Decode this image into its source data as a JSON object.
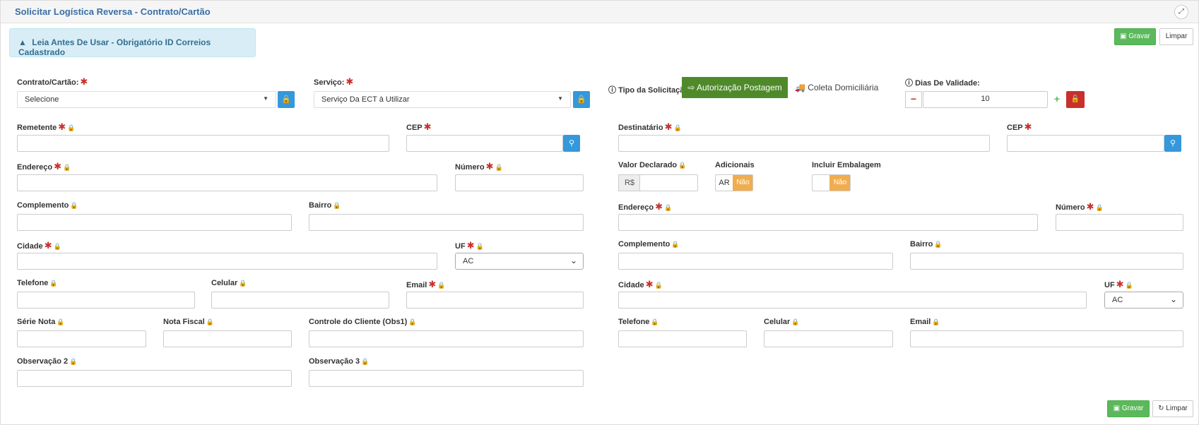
{
  "header": {
    "title": "Solicitar Logística Reversa - Contrato/Cartão",
    "expand_icon": "expand-icon"
  },
  "alert": {
    "text": "Leia Antes De Usar - Obrigatório ID Correios Cadastrado",
    "icon": "warning-icon"
  },
  "toolbar": {
    "save_label": "Gravar",
    "clear_label": "Limpar"
  },
  "footer": {
    "save_label": "Gravar",
    "clear_label": "Limpar"
  },
  "required_mark": "✱",
  "contrato": {
    "label": "Contrato/Cartão:",
    "value": "Selecione"
  },
  "servico": {
    "label": "Serviço:",
    "value": "Serviço Da ECT à Utilizar"
  },
  "tipo": {
    "label": "Tipo da Solicitação",
    "option_active": "Autorização Postagem",
    "option_other": "Coleta Domiciliária"
  },
  "validade": {
    "label": "Dias De Validade:",
    "value": "10"
  },
  "remetente": {
    "nome_label": "Remetente",
    "cep_label": "CEP",
    "endereco_label": "Endereço",
    "numero_label": "Número",
    "complemento_label": "Complemento",
    "bairro_label": "Bairro",
    "cidade_label": "Cidade",
    "uf_label": "UF",
    "uf_value": "AC",
    "telefone_label": "Telefone",
    "celular_label": "Celular",
    "email_label": "Email",
    "serie_label": "Série Nota",
    "nota_label": "Nota Fiscal",
    "controle_label": "Controle do Cliente (Obs1)",
    "obs2_label": "Observação 2",
    "obs3_label": "Observação 3"
  },
  "destinatario": {
    "nome_label": "Destinatário",
    "cep_label": "CEP",
    "valor_label": "Valor Declarado",
    "valor_prefix": "R$",
    "adicionais_label": "Adicionais",
    "ar_label": "AR",
    "ar_value": "Não",
    "embalagem_label": "Incluir Embalagem",
    "embalagem_value": "Não",
    "endereco_label": "Endereço",
    "numero_label": "Número",
    "complemento_label": "Complemento",
    "bairro_label": "Bairro",
    "cidade_label": "Cidade",
    "uf_label": "UF",
    "uf_value": "AC",
    "telefone_label": "Telefone",
    "celular_label": "Celular",
    "email_label": "Email"
  },
  "colors": {
    "title": "#3a6ea5",
    "save": "#5cb85c",
    "auth": "#4f8a2a",
    "search": "#3498db",
    "toggle_off": "#f0ad4e",
    "required": "#c9302c"
  }
}
